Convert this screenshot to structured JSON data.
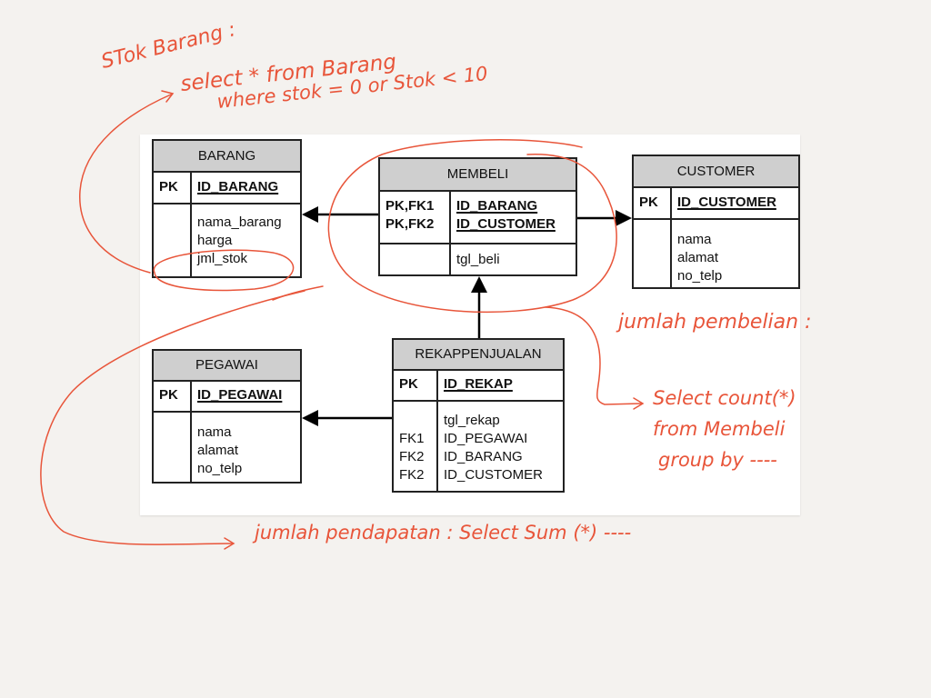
{
  "annotation_color": "#e8553a",
  "entities": {
    "barang": {
      "name": "BARANG",
      "key_label": "PK",
      "key_fields": [
        "ID_BARANG"
      ],
      "attr_labels": [],
      "attributes": [
        "nama_barang",
        "harga",
        "jml_stok"
      ]
    },
    "membeli": {
      "name": "MEMBELI",
      "key_labels": [
        "PK,FK1",
        "PK,FK2"
      ],
      "key_fields": [
        "ID_BARANG",
        "ID_CUSTOMER"
      ],
      "attributes": [
        "tgl_beli"
      ]
    },
    "customer": {
      "name": "CUSTOMER",
      "key_label": "PK",
      "key_fields": [
        "ID_CUSTOMER"
      ],
      "attributes": [
        "nama",
        "alamat",
        "no_telp"
      ]
    },
    "pegawai": {
      "name": "PEGAWAI",
      "key_label": "PK",
      "key_fields": [
        "ID_PEGAWAI"
      ],
      "attributes": [
        "nama",
        "alamat",
        "no_telp"
      ]
    },
    "rekappenjualan": {
      "name": "REKAPPENJUALAN",
      "key_label": "PK",
      "key_fields": [
        "ID_REKAP"
      ],
      "attr_labels": [
        "",
        "FK1",
        "FK2",
        "FK2"
      ],
      "attributes": [
        "tgl_rekap",
        "ID_PEGAWAI",
        "ID_BARANG",
        "ID_CUSTOMER"
      ]
    }
  },
  "relationships": [
    {
      "from": "MEMBELI",
      "to": "BARANG"
    },
    {
      "from": "MEMBELI",
      "to": "CUSTOMER"
    },
    {
      "from": "REKAPPENJUALAN",
      "to": "MEMBELI"
    },
    {
      "from": "REKAPPENJUALAN",
      "to": "PEGAWAI"
    }
  ],
  "annotations": {
    "stok_title": "STok Barang :",
    "stok_line1": "select * from Barang",
    "stok_line2": "where   stok = 0   or   Stok < 10",
    "pembelian_title": "jumlah pembelian :",
    "pembelian_line1": "Select  count(*)",
    "pembelian_line2": "from Membeli",
    "pembelian_line3": "group by ----",
    "pendapatan": "jumlah pendapatan :   Select   Sum (*)  ----"
  }
}
